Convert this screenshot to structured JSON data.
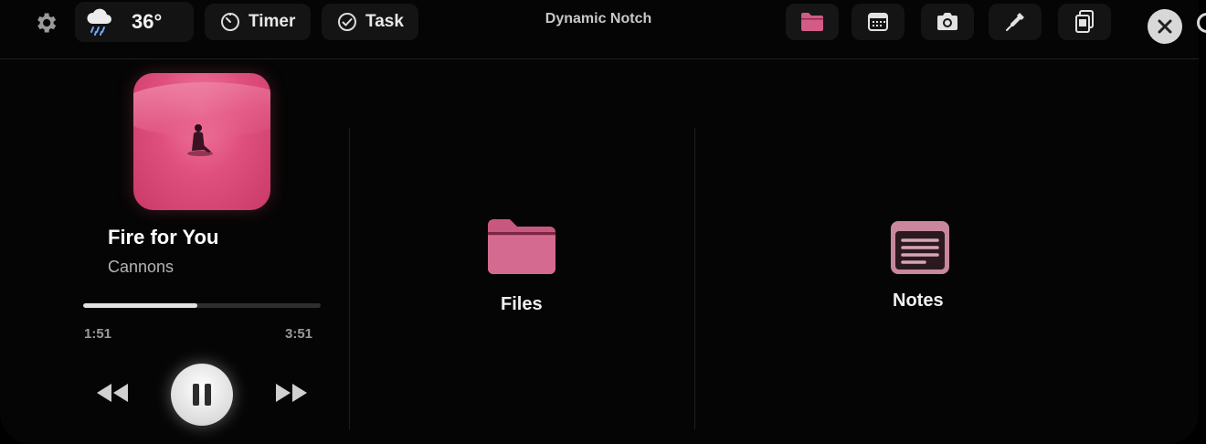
{
  "app": {
    "title": "Dynamic Notch"
  },
  "topbar": {
    "weather": {
      "icon": "rain-cloud-icon",
      "temperature": "36°"
    },
    "timer_label": "Timer",
    "task_label": "Task",
    "tools": [
      {
        "name": "files",
        "icon": "folder-icon"
      },
      {
        "name": "calendar",
        "icon": "calendar-icon"
      },
      {
        "name": "camera",
        "icon": "camera-icon"
      },
      {
        "name": "color-picker",
        "icon": "eyedropper-icon"
      },
      {
        "name": "clipboard",
        "icon": "clipboard-icon"
      }
    ]
  },
  "player": {
    "title": "Fire for You",
    "artist": "Cannons",
    "elapsed": "1:51",
    "duration": "3:51",
    "progress_fraction": 0.48
  },
  "shortcuts": {
    "files_label": "Files",
    "notes_label": "Notes"
  },
  "colors": {
    "accent": "#d35b85",
    "background": "#050505",
    "notes_frame": "#c8879d"
  }
}
